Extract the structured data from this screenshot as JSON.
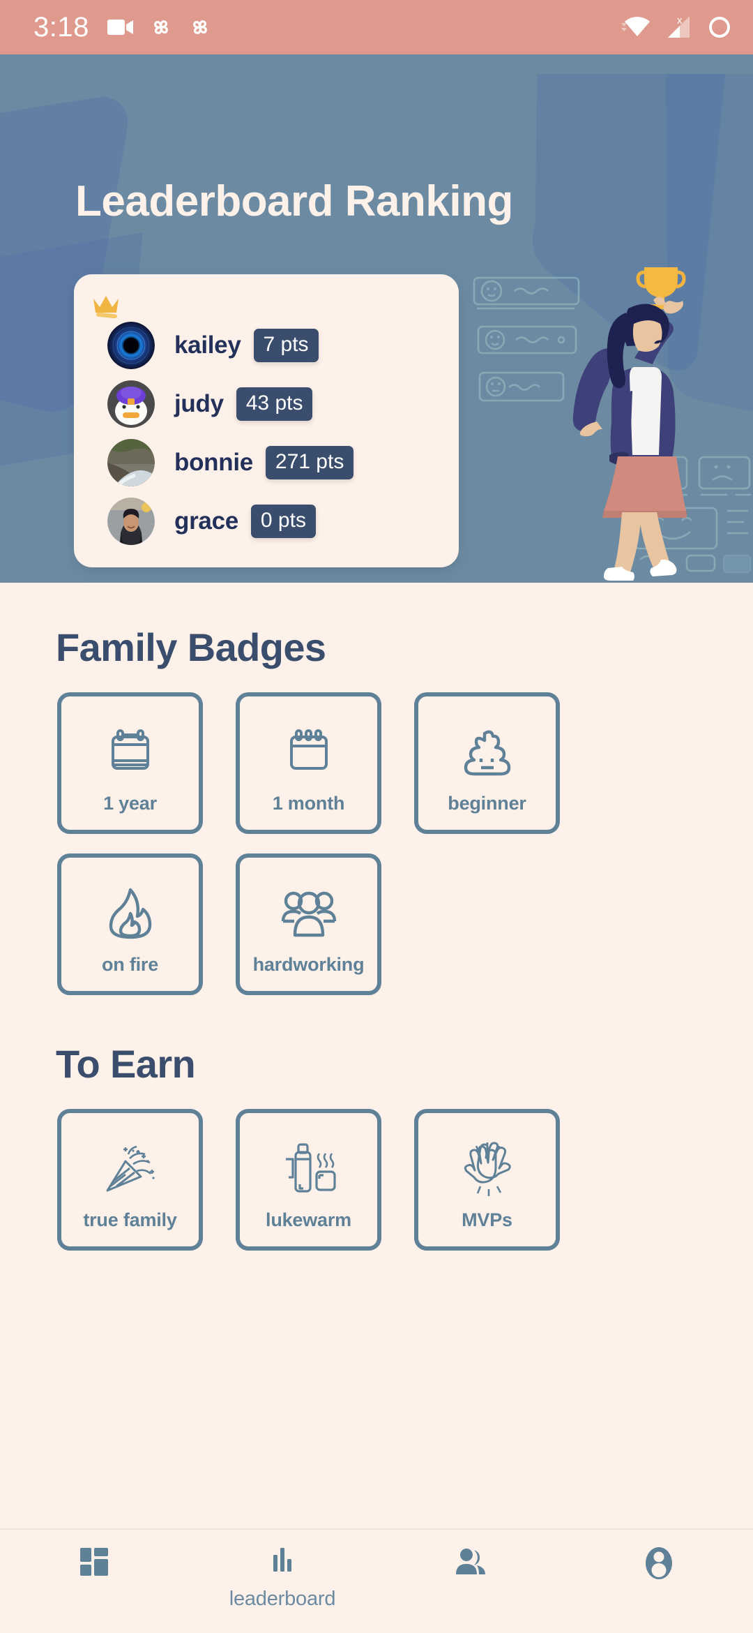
{
  "status_bar": {
    "time": "3:18",
    "left_icons": [
      "video-camera-icon",
      "pinwheel-icon",
      "pinwheel-icon"
    ],
    "right_icons": [
      "wifi-icon",
      "cellular-no-sim-icon",
      "battery-circle-icon"
    ],
    "background_color": "#df9a8d"
  },
  "header": {
    "title": "Leaderboard Ranking",
    "background_color": "#6c8ba3",
    "illustration": "woman-holding-trophy-illustration"
  },
  "leaderboard": {
    "crown_icon": "crown-icon",
    "card_background": "#fdf1e9",
    "points_badge_color": "#3a4d6d",
    "entries": [
      {
        "name": "kailey",
        "points": "7 pts",
        "avatar": "avatar-blue-eye-portal"
      },
      {
        "name": "judy",
        "points": "43 pts",
        "avatar": "avatar-penguin-purple-hat"
      },
      {
        "name": "bonnie",
        "points": "271 pts",
        "avatar": "avatar-creek-landscape-photo"
      },
      {
        "name": "grace",
        "points": "0 pts",
        "avatar": "avatar-girl-portrait-photo"
      }
    ]
  },
  "family_badges": {
    "title": "Family Badges",
    "items": [
      {
        "label": "1 year",
        "icon": "calendar-year-icon"
      },
      {
        "label": "1 month",
        "icon": "calendar-month-icon"
      },
      {
        "label": "beginner",
        "icon": "poop-icon"
      },
      {
        "label": "on fire",
        "icon": "flame-icon"
      },
      {
        "label": "hardworking",
        "icon": "group-people-icon"
      }
    ]
  },
  "to_earn": {
    "title": "To Earn",
    "items": [
      {
        "label": "true family",
        "icon": "party-popper-icon"
      },
      {
        "label": "lukewarm",
        "icon": "thermos-mug-icon"
      },
      {
        "label": "MVPs",
        "icon": "high-five-hands-icon"
      }
    ]
  },
  "bottom_nav": {
    "accent_color": "#5f8198",
    "items": [
      {
        "label": "",
        "icon": "dashboard-grid-icon",
        "selected": false
      },
      {
        "label": "leaderboard",
        "icon": "bar-chart-icon",
        "selected": true
      },
      {
        "label": "",
        "icon": "people-group-icon",
        "selected": false
      },
      {
        "label": "",
        "icon": "account-circle-icon",
        "selected": false
      }
    ]
  }
}
